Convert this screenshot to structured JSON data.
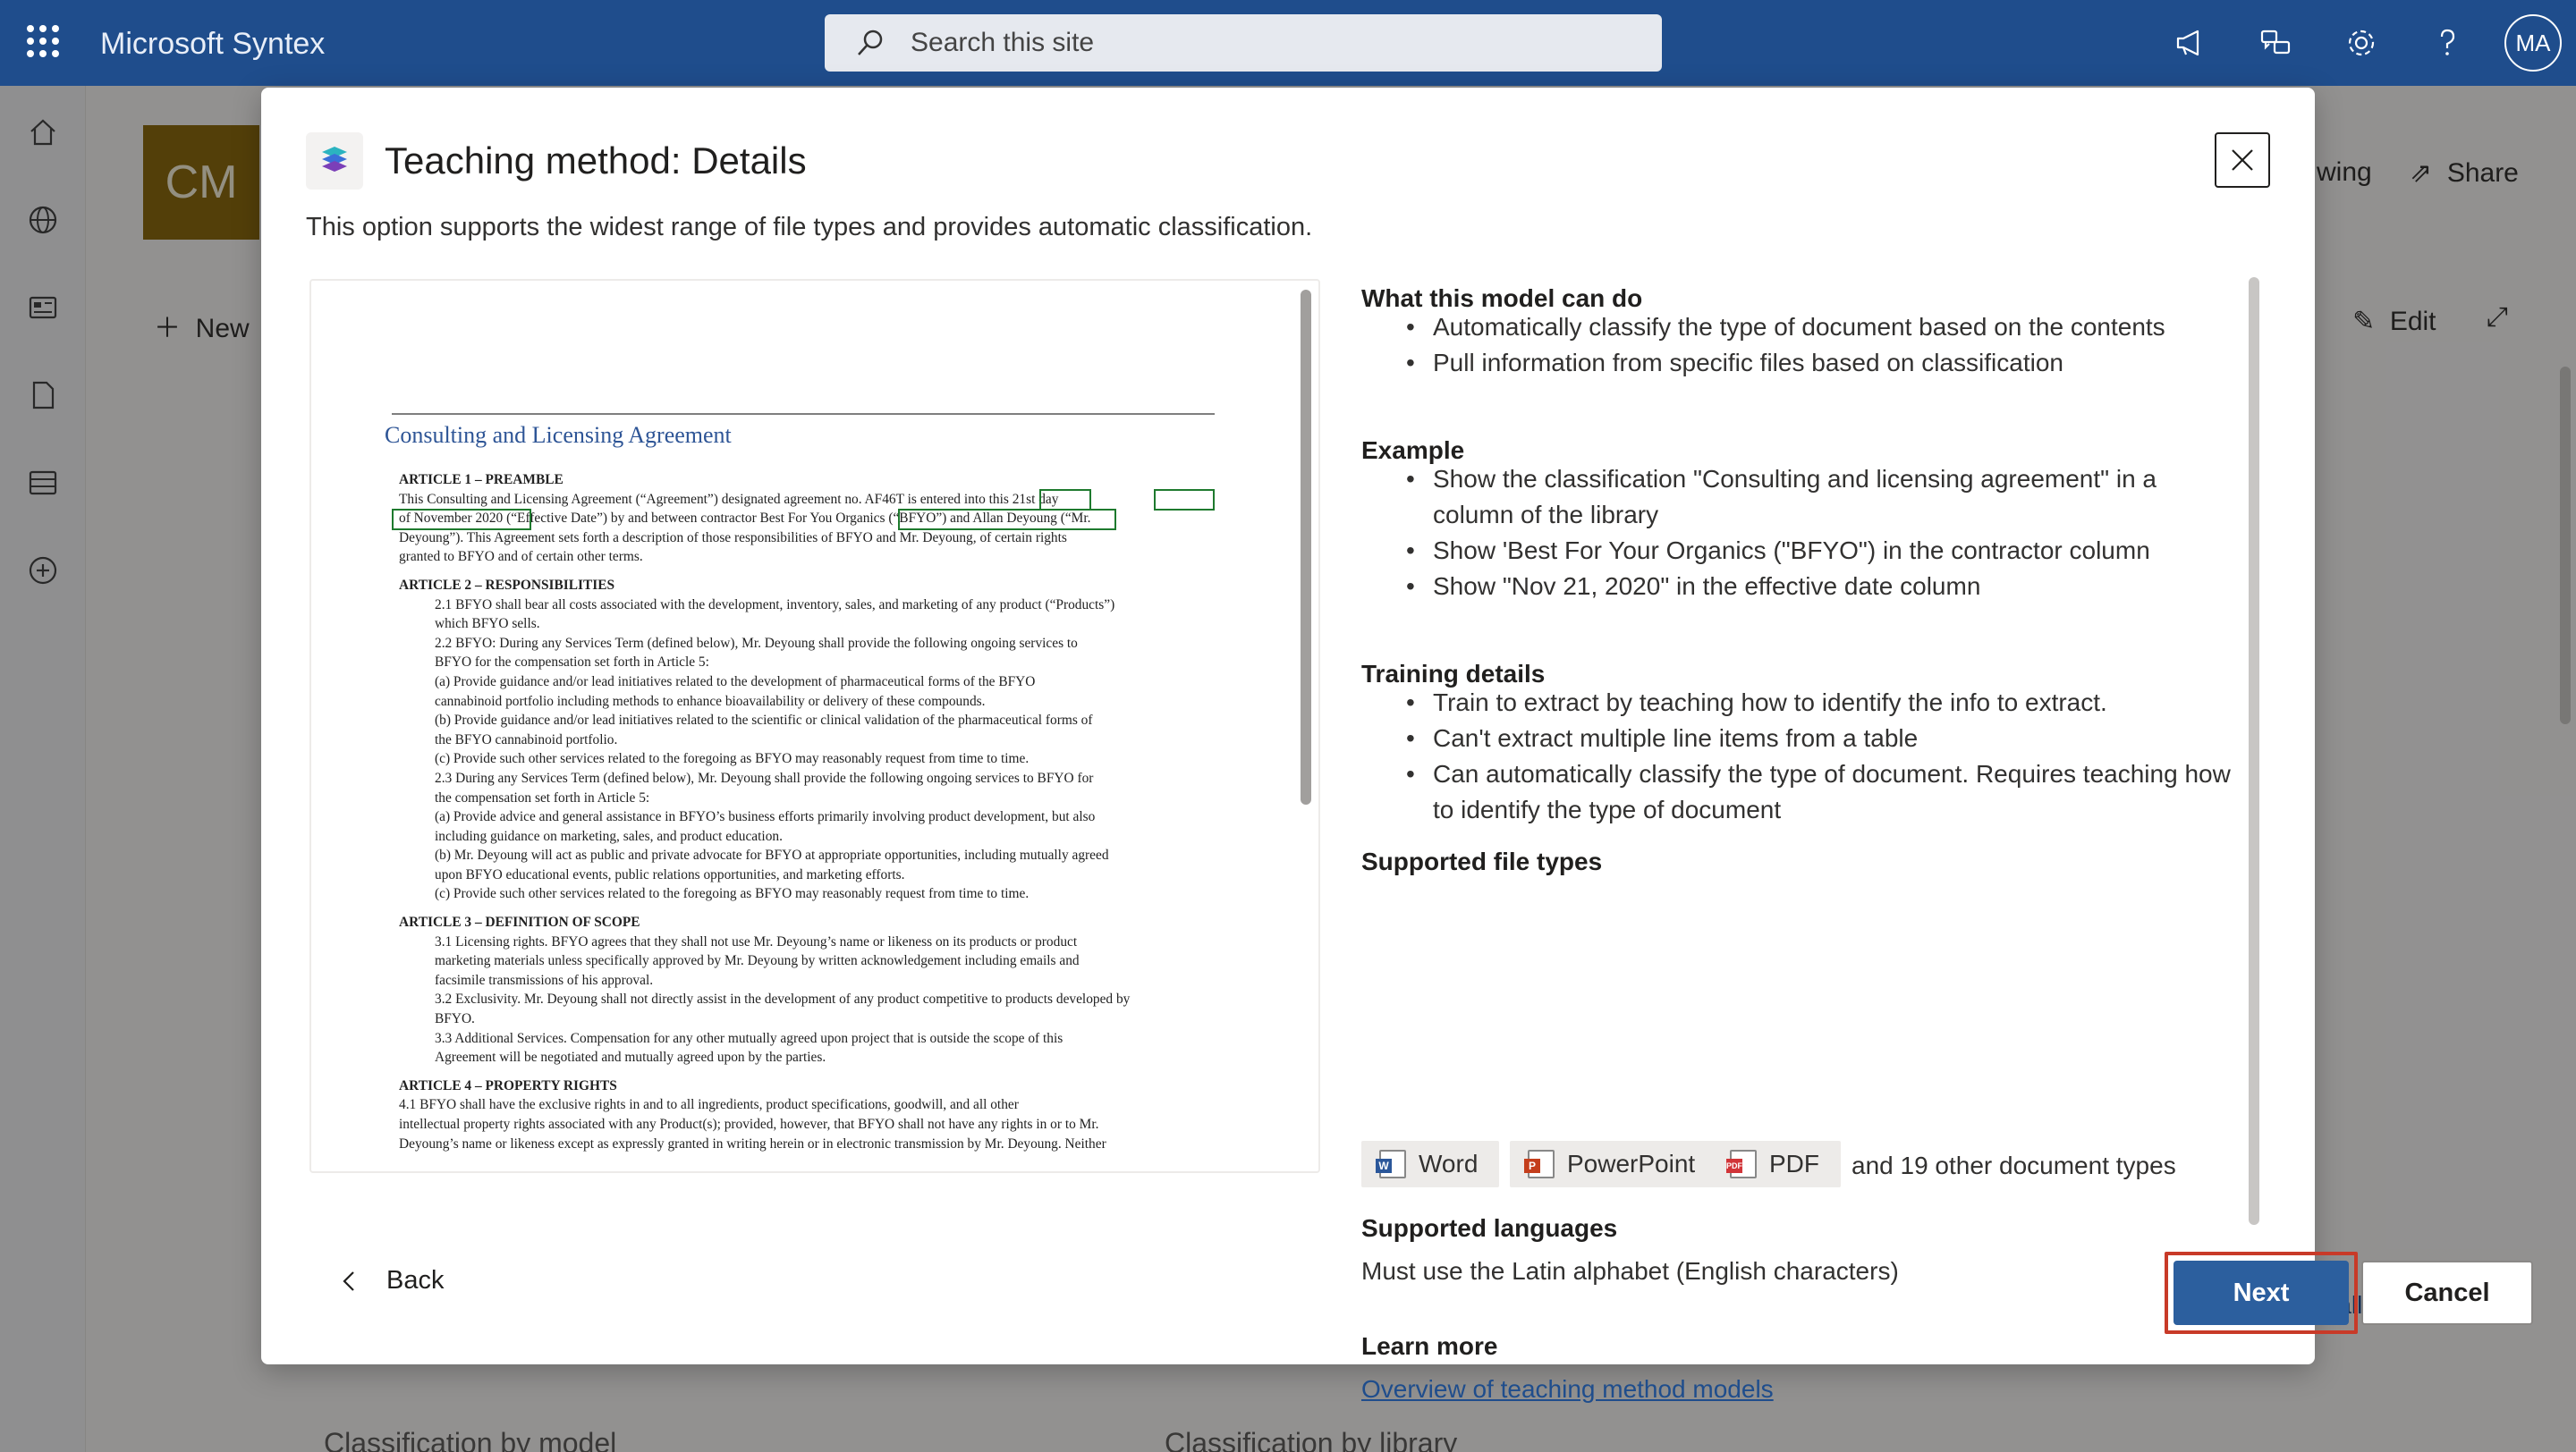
{
  "topbar": {
    "app_title": "Microsoft Syntex",
    "search_placeholder": "Search this site",
    "user_initials": "MA",
    "icons": [
      "waffle-icon",
      "megaphone-icon",
      "feedback-icon",
      "gear-icon",
      "help-icon"
    ]
  },
  "rail": {
    "icons": [
      "home-icon",
      "globe-icon",
      "news-icon",
      "document-icon",
      "list-icon",
      "add-circle-icon"
    ]
  },
  "background_page": {
    "site_logo": "CM",
    "new_label": "New",
    "following_label": "wing",
    "share_label": "Share",
    "edit_label": "Edit",
    "see_all_label": "e all",
    "classification_by_model": "Classification by model",
    "classification_by_library": "Classification by library"
  },
  "dialog": {
    "title": "Teaching method: Details",
    "subtitle": "This option supports the widest range of file types and provides automatic classification.",
    "preview": {
      "doc_title": "Consulting and Licensing Agreement",
      "lines": [
        {
          "cls": "h",
          "text": "ARTICLE 1 – PREAMBLE"
        },
        {
          "cls": "",
          "text": "          This Consulting and Licensing Agreement (“Agreement”) designated agreement no. AF46T is entered into this 21st day"
        },
        {
          "cls": "",
          "text": "  of November 2020  (“Effective Date”) by and between contractor Best For You Organics (“BFYO”) and Allan Deyoung (“Mr."
        },
        {
          "cls": "",
          "text": "  Deyoung”). This Agreement sets forth a description of those responsibilities of BFYO and Mr. Deyoung, of certain rights"
        },
        {
          "cls": "",
          "text": "  granted to BFYO and of certain other terms."
        },
        {
          "cls": "h gap",
          "text": "ARTICLE 2 – RESPONSIBILITIES"
        },
        {
          "cls": "ind",
          "text": "2.1 BFYO shall bear all costs associated with the development, inventory, sales, and marketing of any product (“Products”)"
        },
        {
          "cls": "ind",
          "text": "     which BFYO sells."
        },
        {
          "cls": "ind",
          "text": "2.2 BFYO: During any Services Term (defined below), Mr. Deyoung shall provide the following ongoing services to"
        },
        {
          "cls": "ind",
          "text": "     BFYO for the compensation set forth in Article 5:"
        },
        {
          "cls": "ind",
          "text": "(a)  Provide guidance and/or lead initiatives related to the development of pharmaceutical forms of the BFYO"
        },
        {
          "cls": "ind",
          "text": "      cannabinoid portfolio including methods to enhance bioavailability or delivery of these compounds."
        },
        {
          "cls": "ind",
          "text": "(b)  Provide guidance and/or lead initiatives related to the scientific or clinical validation of the pharmaceutical forms of"
        },
        {
          "cls": "ind",
          "text": "      the BFYO cannabinoid portfolio."
        },
        {
          "cls": "ind",
          "text": "(c)  Provide such other services related to the foregoing as BFYO may reasonably request from time to time."
        },
        {
          "cls": "ind",
          "text": "2.3 During any Services Term (defined below), Mr. Deyoung shall provide the following ongoing services to BFYO for"
        },
        {
          "cls": "ind",
          "text": "     the compensation set forth in Article 5:"
        },
        {
          "cls": "ind",
          "text": "(a)  Provide advice and general assistance in BFYO’s business efforts primarily involving product development, but also"
        },
        {
          "cls": "ind",
          "text": "      including guidance on marketing, sales, and product education."
        },
        {
          "cls": "ind",
          "text": "(b)  Mr. Deyoung will act as public and private advocate for BFYO at appropriate opportunities, including mutually agreed"
        },
        {
          "cls": "ind",
          "text": "      upon BFYO educational events, public relations opportunities, and marketing efforts."
        },
        {
          "cls": "ind",
          "text": "(c)  Provide such other services related to the foregoing as BFYO may reasonably request from time to time."
        },
        {
          "cls": "h gap",
          "text": "ARTICLE 3 – DEFINITION OF SCOPE"
        },
        {
          "cls": "ind",
          "text": "3.1 Licensing rights. BFYO agrees that they shall not use Mr. Deyoung’s name or likeness on its products or product"
        },
        {
          "cls": "ind",
          "text": "     marketing materials unless specifically approved by Mr. Deyoung by written acknowledgement including emails and"
        },
        {
          "cls": "ind",
          "text": "     facsimile transmissions of his approval."
        },
        {
          "cls": "ind",
          "text": "3.2 Exclusivity. Mr. Deyoung shall not directly assist in the development of any product competitive to products developed by"
        },
        {
          "cls": "ind",
          "text": "     BFYO."
        },
        {
          "cls": "ind",
          "text": "3.3 Additional Services. Compensation for any other mutually agreed upon project that is outside the scope of this"
        },
        {
          "cls": "ind",
          "text": "     Agreement will be negotiated and mutually agreed upon by the parties."
        },
        {
          "cls": "h gap",
          "text": "ARTICLE 4 – PROPERTY RIGHTS"
        },
        {
          "cls": "",
          "text": "     4.1 BFYO shall have the exclusive rights in and to all ingredients, product specifications, goodwill, and all other"
        },
        {
          "cls": "",
          "text": "  intellectual property rights associated with any Product(s); provided, however, that BFYO shall not have any rights in or to Mr."
        },
        {
          "cls": "",
          "text": "  Deyoung’s name or likeness except as expressly granted in writing herein or in electronic transmission by Mr. Deyoung. Neither"
        }
      ]
    },
    "info": {
      "can_do_heading": "What this model can do",
      "can_do": [
        "Automatically classify the type of document based on the contents",
        "Pull information from specific files based on classification"
      ],
      "example_heading": "Example",
      "examples": [
        "Show the classification \"Consulting and licensing agreement\" in a column of the library",
        "Show 'Best For Your Organics (\"BFYO\") in the contractor column",
        "Show \"Nov 21, 2020\" in the effective date column"
      ],
      "training_heading": "Training details",
      "training": [
        "Train to extract by teaching how to identify the info to extract.",
        "Can't extract multiple line items from a table",
        "Can automatically classify the type of document. Requires teaching how to identify the type of document"
      ],
      "file_types_heading": "Supported file types",
      "file_types": [
        "Word",
        "PowerPoint",
        "PDF"
      ],
      "more_types": "and 19 other document types",
      "languages_heading": "Supported languages",
      "languages_text": "Must use the Latin alphabet (English characters)",
      "learn_heading": "Learn more",
      "learn_link": "Overview of teaching method models"
    },
    "footer": {
      "back_label": "Back",
      "next_label": "Next",
      "cancel_label": "Cancel"
    },
    "colors": {
      "primary": "#2c5f9e",
      "highlight_border": "#c83a28",
      "doc_highlight": "#1e7a2e"
    }
  }
}
